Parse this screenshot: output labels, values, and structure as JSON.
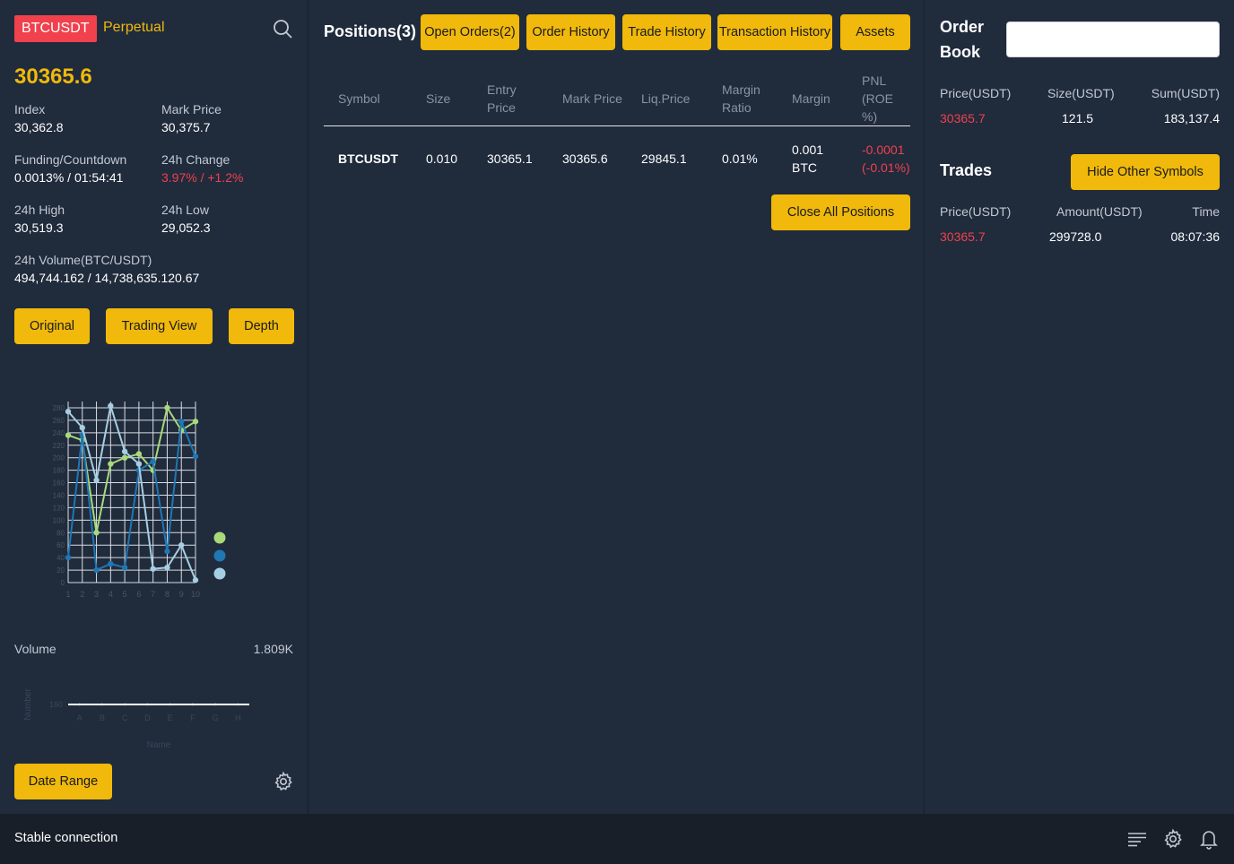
{
  "header": {
    "symbol": "BTCUSDT",
    "contract_type": "Perpetual",
    "last_price": "30365.6"
  },
  "stats": [
    {
      "label": "Index",
      "value": "30,362.8"
    },
    {
      "label": "Mark Price",
      "value": "30,375.7"
    },
    {
      "label": "Funding/Countdown",
      "value": "0.0013% / 01:54:41"
    },
    {
      "label": "24h Change",
      "value": "3.97% / +1.2%"
    },
    {
      "label": "24h High",
      "value": "30,519.3"
    },
    {
      "label": "24h Low",
      "value": "29,052.3"
    },
    {
      "label": "24h Volume(BTC/USDT)",
      "value": "494,744.162 / 14,738,635.120.67"
    }
  ],
  "chart_buttons": [
    "Original",
    "Trading View",
    "Depth"
  ],
  "chart_data": [
    {
      "type": "line",
      "x": [
        1,
        2,
        3,
        4,
        5,
        6,
        7,
        8,
        9,
        10
      ],
      "series": [
        {
          "color": "#a8d97a",
          "values": [
            236,
            228,
            80,
            190,
            200,
            206,
            180,
            280,
            244,
            258
          ]
        },
        {
          "color": "#1f77b4",
          "values": [
            40,
            236,
            20,
            30,
            24,
            180,
            194,
            50,
            258,
            202
          ]
        },
        {
          "color": "#a6cee3",
          "values": [
            274,
            248,
            164,
            283,
            210,
            190,
            22,
            24,
            60,
            4
          ]
        }
      ],
      "ylim": [
        0,
        290
      ],
      "yticks": [
        0,
        20,
        40,
        60,
        80,
        100,
        120,
        140,
        160,
        180,
        200,
        220,
        240,
        260,
        280
      ],
      "grid": true,
      "legend": "right"
    },
    {
      "type": "line",
      "categories": [
        "A",
        "B",
        "C",
        "D",
        "E",
        "F",
        "G",
        "H"
      ],
      "series": [
        {
          "color": "#ffffff",
          "values": [
            160,
            160,
            160,
            160,
            160,
            160,
            160,
            160
          ]
        }
      ],
      "ylabel": "Number",
      "xlabel": "Name",
      "yticks": [
        160
      ]
    }
  ],
  "volume": {
    "label": "Volume",
    "value": "1.809K"
  },
  "date_range_label": "Date Range",
  "positions": {
    "title": "Positions(3)",
    "tabs": [
      "Open Orders(2)",
      "Order History",
      "Trade History",
      "Transaction History",
      "Assets"
    ],
    "columns": [
      "Symbol",
      "Size",
      "Entry Price",
      "Mark Price",
      "Liq.Price",
      "Margin Ratio",
      "Margin",
      "PNL (ROE %)"
    ],
    "rows": [
      {
        "symbol": "BTCUSDT",
        "size": "0.010",
        "entry_price": "30365.1",
        "mark_price": "30365.6",
        "liq_price": "29845.1",
        "margin_ratio": "0.01%",
        "margin": "0.001 BTC",
        "pnl": "-0.0001 (-0.01%)"
      }
    ],
    "close_all_label": "Close All Positions"
  },
  "order_book": {
    "title": "Order Book",
    "search_value": "",
    "columns": [
      "Price(USDT)",
      "Size(USDT)",
      "Sum(USDT)"
    ],
    "rows": [
      {
        "price": "30365.7",
        "size": "121.5",
        "sum": "183,137.4"
      }
    ]
  },
  "trades": {
    "title": "Trades",
    "hide_button": "Hide Other Symbols",
    "columns": [
      "Price(USDT)",
      "Amount(USDT)",
      "Time"
    ],
    "rows": [
      {
        "price": "30365.7",
        "amount": "299728.0",
        "time": "08:07:36"
      }
    ]
  },
  "status": {
    "text": "Stable connection"
  },
  "colors": {
    "accent": "#f0b90b",
    "sell": "#f0414d",
    "panel": "#202b3c",
    "statusbar": "#181f29"
  }
}
